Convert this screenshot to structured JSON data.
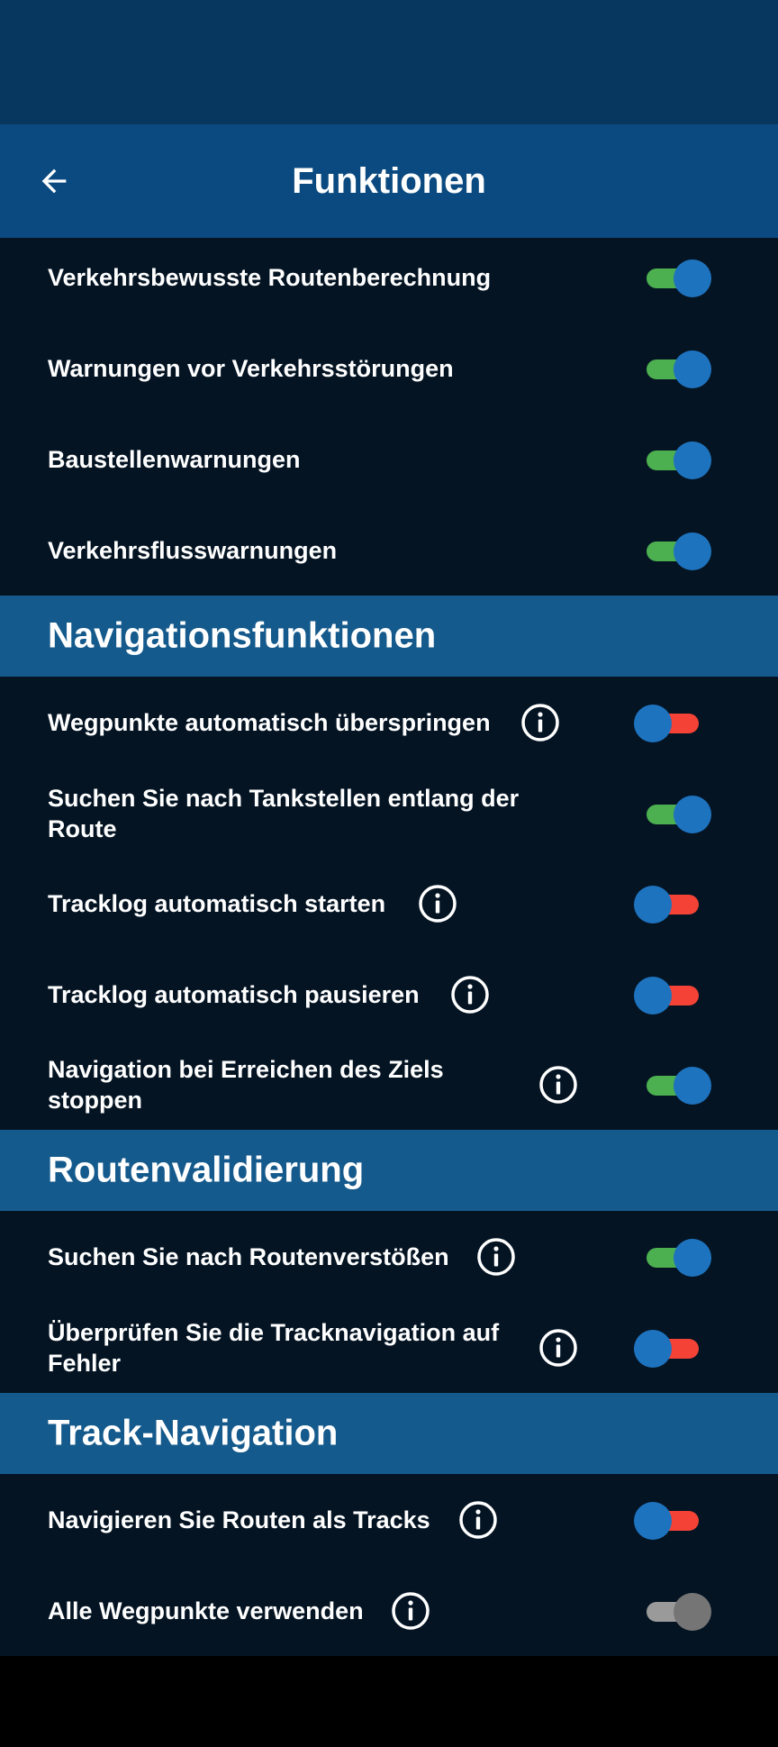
{
  "header": {
    "title": "Funktionen"
  },
  "colors": {
    "status_bar": "#07365e",
    "app_bar": "#0b4a80",
    "background": "#041423",
    "section_header": "#155a8c",
    "toggle_on_track": "#4caf50",
    "toggle_off_track": "#f44336",
    "toggle_thumb": "#1e73bf",
    "toggle_disabled": "#757575"
  },
  "icons": {
    "back": "arrow-left-icon",
    "info": "info-circle-icon"
  },
  "traffic": {
    "items": [
      {
        "label": "Verkehrsbewusste Routenberechnung",
        "state": "on"
      },
      {
        "label": "Warnungen vor Verkehrsstörungen",
        "state": "on"
      },
      {
        "label": "Baustellenwarnungen",
        "state": "on"
      },
      {
        "label": "Verkehrsflusswarnungen",
        "state": "on"
      }
    ]
  },
  "navigation": {
    "title": "Navigationsfunktionen",
    "items": [
      {
        "label": "Wegpunkte automatisch überspringen",
        "state": "off",
        "info": true
      },
      {
        "label": "Suchen Sie nach Tankstellen entlang der Route",
        "state": "on",
        "info": false
      },
      {
        "label": "Tracklog automatisch starten",
        "state": "off",
        "info": true
      },
      {
        "label": "Tracklog automatisch pausieren",
        "state": "off",
        "info": true
      },
      {
        "label": "Navigation bei Erreichen des Ziels stoppen",
        "state": "on",
        "info": true
      }
    ]
  },
  "validation": {
    "title": "Routenvalidierung",
    "items": [
      {
        "label": "Suchen Sie nach Routenverstößen",
        "state": "on",
        "info": true
      },
      {
        "label": "Überprüfen Sie die Tracknavigation auf Fehler",
        "state": "off",
        "info": true
      }
    ]
  },
  "track_navigation": {
    "title": "Track-Navigation",
    "items": [
      {
        "label": "Navigieren Sie Routen als Tracks",
        "state": "off",
        "info": true
      },
      {
        "label": "Alle Wegpunkte verwenden",
        "state": "disabled",
        "info": true
      }
    ]
  }
}
